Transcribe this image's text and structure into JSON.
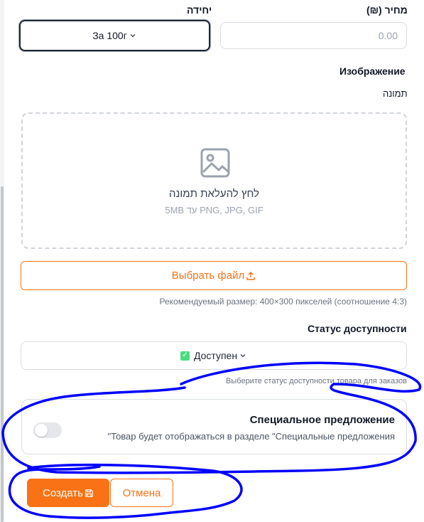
{
  "form": {
    "unit_label": "יחידה",
    "unit_value": "За 100г",
    "price_label": "מחיר (₪)",
    "price_placeholder": "0.00",
    "image_section_title": "Изображение",
    "image_field_label": "תמונה",
    "dropzone_title": "לחץ להעלאת תמונה",
    "dropzone_subtitle": "5MB עד PNG, JPG, GIF",
    "choose_file_label": "Выбрать файл",
    "recommended_size": "Рекомендуемый размер: 400×300 пикселей (соотношение 4:3)",
    "availability_title": "Статус доступности",
    "availability_value": "Доступен",
    "availability_hint": "Выберите статус доступности товара для заказов",
    "special_offer_title": "Специальное предложение",
    "special_offer_desc": "\"Товар будет отображаться в разделе \"Специальные предложения",
    "special_offer_enabled": false
  },
  "actions": {
    "create_label": "Создать",
    "cancel_label": "Отмена"
  },
  "colors": {
    "accent": "#f97316",
    "annotation": "#0000ff"
  }
}
